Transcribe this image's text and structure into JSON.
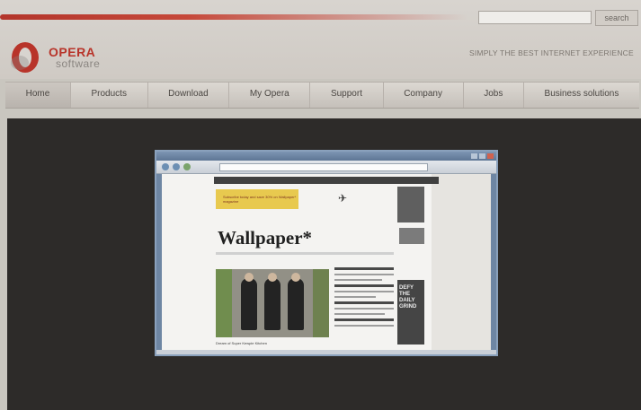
{
  "header": {
    "search_placeholder": "",
    "search_button_label": "search",
    "tagline": "SIMPLY THE BEST INTERNET EXPERIENCE",
    "logo_word": "OPERA",
    "logo_sub": "software"
  },
  "nav": {
    "items": [
      {
        "label": "Home"
      },
      {
        "label": "Products"
      },
      {
        "label": "Download"
      },
      {
        "label": "My Opera"
      },
      {
        "label": "Support"
      },
      {
        "label": "Company"
      },
      {
        "label": "Jobs"
      },
      {
        "label": "Business solutions"
      }
    ]
  },
  "embedded_screenshot": {
    "page_title": "Wallpaper*",
    "ad_text": "Subscribe today and save 30% on Wallpaper* magazine",
    "right_ad_text": "DEFY THE DAILY GRIND",
    "photo_caption": "Dream of Super Kewpie Kitchen"
  },
  "colors": {
    "brand_red": "#b8342a",
    "dark_background": "#2d2b29",
    "header_bg": "#d3cfca"
  }
}
